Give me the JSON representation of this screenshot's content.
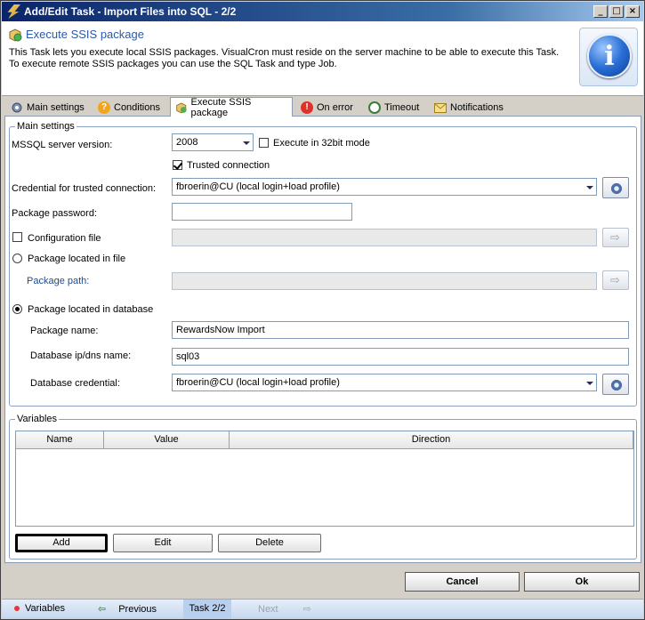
{
  "window": {
    "title": "Add/Edit Task - Import Files into SQL - 2/2"
  },
  "header": {
    "title": "Execute SSIS package",
    "description": "This Task lets you execute local SSIS packages. VisualCron must reside on the server machine to be able to execute this Task. To execute remote SSIS packages you can use the SQL Task and type Job."
  },
  "tabs": [
    {
      "label": "Main settings",
      "icon": "gear-icon"
    },
    {
      "label": "Conditions",
      "icon": "question-icon"
    },
    {
      "label": "Execute SSIS package",
      "icon": "package-icon",
      "active": true
    },
    {
      "label": "On error",
      "icon": "error-icon"
    },
    {
      "label": "Timeout",
      "icon": "clock-icon"
    },
    {
      "label": "Notifications",
      "icon": "envelope-icon"
    }
  ],
  "main": {
    "group_label": "Main settings",
    "mssql_label": "MSSQL server version:",
    "mssql_value": "2008",
    "exec32_label": "Execute in 32bit mode",
    "trusted_label": "Trusted connection",
    "credential_label": "Credential for trusted connection:",
    "credential_value": "fbroerin@CU (local login+load profile)",
    "password_label": "Package password:",
    "password_value": "",
    "config_label": "Configuration file",
    "config_value": "",
    "file_radio_label": "Package located in file",
    "path_label": "Package path:",
    "path_value": "",
    "db_radio_label": "Package located in database",
    "pkg_name_label": "Package name:",
    "pkg_name_value": "RewardsNow Import",
    "db_ip_label": "Database ip/dns name:",
    "db_ip_value": "sql03",
    "db_cred_label": "Database credential:",
    "db_cred_value": "fbroerin@CU (local login+load profile)"
  },
  "variables": {
    "group_label": "Variables",
    "columns": [
      "Name",
      "Value",
      "Direction"
    ],
    "add_label": "Add",
    "edit_label": "Edit",
    "delete_label": "Delete"
  },
  "footer": {
    "cancel_label": "Cancel",
    "ok_label": "Ok"
  },
  "status": {
    "variables_label": "Variables",
    "previous_label": "Previous",
    "task_label": "Task 2/2",
    "next_label": "Next"
  }
}
